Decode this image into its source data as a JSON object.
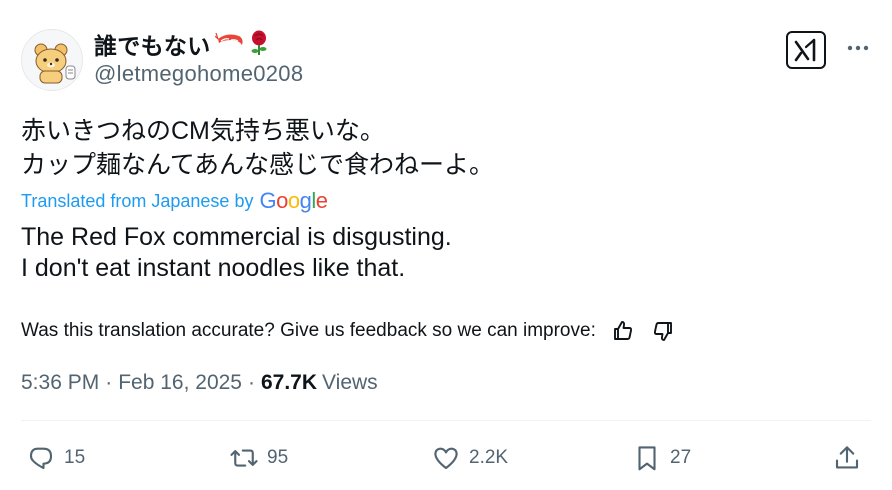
{
  "author": {
    "display_name": "誰でもない",
    "handle": "@letmegohome0208",
    "avatar": "cartoon-bear-avatar"
  },
  "tweet": {
    "original_lines": [
      "赤いきつねのCM気持ち悪いな。",
      "カップ麺なんてあんな感じで食わねーよ。"
    ],
    "translated_label": "Translated from Japanese by",
    "translation_provider": "Google",
    "translation_lines": [
      "The Red Fox commercial is disgusting.",
      "I don't eat instant noodles like that."
    ],
    "feedback_prompt": "Was this translation accurate? Give us feedback so we can improve:",
    "time": "5:36 PM",
    "separator": "·",
    "date": "Feb 16, 2025",
    "views_count": "67.7K",
    "views_label": "Views"
  },
  "actions": {
    "replies": "15",
    "reposts": "95",
    "likes": "2.2K",
    "bookmarks": "27"
  },
  "icons": {
    "grok": "grok-icon",
    "more": "more-dots-icon",
    "thumbs_up": "thumbs-up-icon",
    "thumbs_down": "thumbs-down-icon",
    "reply": "reply-icon",
    "repost": "repost-icon",
    "like": "heart-icon",
    "bookmark": "bookmark-icon",
    "share": "share-icon"
  },
  "colors": {
    "link_blue": "#1d9bf0",
    "secondary_text": "#536471",
    "primary_text": "#0f1419"
  }
}
